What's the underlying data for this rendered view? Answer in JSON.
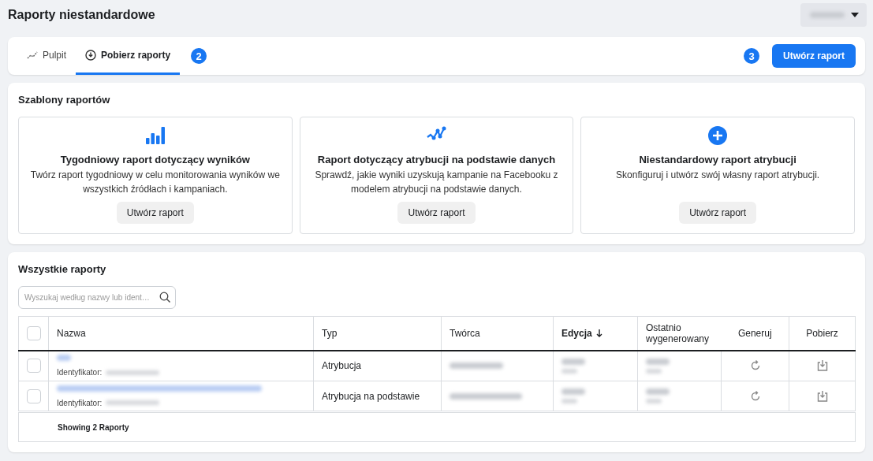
{
  "page": {
    "title": "Raporty niestandardowe"
  },
  "tabs": [
    {
      "label": "Pulpit",
      "selected": false
    },
    {
      "label": "Pobierz raporty",
      "selected": true
    }
  ],
  "tab_marker": "2",
  "action_marker": "3",
  "create_button": "Utwórz raport",
  "templates": {
    "title": "Szablony raportów",
    "cards": [
      {
        "title": "Tygodniowy raport dotyczący wyników",
        "description": "Twórz raport tygodniowy w celu monitorowania wyników we wszystkich źródłach i kampaniach.",
        "button": "Utwórz raport"
      },
      {
        "title": "Raport dotyczący atrybucji na podstawie danych",
        "description": "Sprawdź, jakie wyniki uzyskują kampanie na Facebooku z modelem atrybucji na podstawie danych.",
        "button": "Utwórz raport"
      },
      {
        "title": "Niestandardowy raport atrybucji",
        "description": "Skonfiguruj i utwórz swój własny raport atrybucji.",
        "button": "Utwórz raport"
      }
    ]
  },
  "reports": {
    "title": "Wszystkie raporty",
    "search": {
      "placeholder": "Wyszukaj według nazwy lub ident…"
    },
    "select_all": {
      "checked": false
    },
    "columns": [
      {
        "label": "Nazwa",
        "sorted": false
      },
      {
        "label": "Typ",
        "sorted": false
      },
      {
        "label": "Twórca",
        "sorted": false
      },
      {
        "label": "Edycja",
        "sorted": true
      },
      {
        "label": "Ostatnio wygenerowany",
        "sorted": false
      },
      {
        "label": "Generuj",
        "sorted": false
      },
      {
        "label": "Pobierz",
        "sorted": false
      }
    ],
    "rows": [
      {
        "checked": false,
        "id_label": "Identyfikator:",
        "type": "Atrybucja"
      },
      {
        "checked": false,
        "id_label": "Identyfikator:",
        "type": "Atrybucja na podstawie"
      }
    ],
    "footer": "Showing 2 Raporty"
  }
}
